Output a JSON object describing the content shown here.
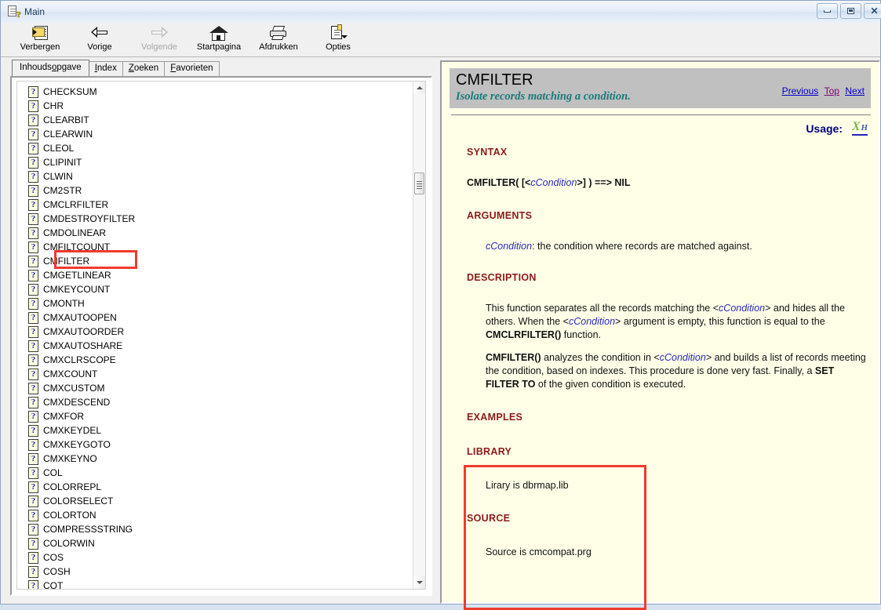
{
  "window": {
    "title": "Main",
    "icon": "help-document-icon",
    "buttons": {
      "minimize": "minimize",
      "restore": "restore",
      "close": "close"
    }
  },
  "toolbar": {
    "items": [
      {
        "label": "Verbergen",
        "icon": "hide-panel-icon",
        "enabled": true
      },
      {
        "label": "Vorige",
        "icon": "back-arrow-icon",
        "enabled": true
      },
      {
        "label": "Volgende",
        "icon": "forward-arrow-icon",
        "enabled": false
      },
      {
        "label": "Startpagina",
        "icon": "home-icon",
        "enabled": true
      },
      {
        "label": "Afdrukken",
        "icon": "printer-icon",
        "enabled": true
      },
      {
        "label": "Opties",
        "icon": "options-icon",
        "enabled": true
      }
    ]
  },
  "nav": {
    "tabs": [
      {
        "label": "Inhoudsopgave",
        "accesskey": "o",
        "active": true
      },
      {
        "label": "Index",
        "accesskey": "I",
        "active": false
      },
      {
        "label": "Zoeken",
        "accesskey": "Z",
        "active": false
      },
      {
        "label": "Favorieten",
        "accesskey": "F",
        "active": false
      }
    ],
    "tree_items": [
      "CHECKSUM",
      "CHR",
      "CLEARBIT",
      "CLEARWIN",
      "CLEOL",
      "CLIPINIT",
      "CLWIN",
      "CM2STR",
      "CMCLRFILTER",
      "CMDESTROYFILTER",
      "CMDOLINEAR",
      "CMFILTCOUNT",
      "CMFILTER",
      "CMGETLINEAR",
      "CMKEYCOUNT",
      "CMONTH",
      "CMXAUTOOPEN",
      "CMXAUTOORDER",
      "CMXAUTOSHARE",
      "CMXCLRSCOPE",
      "CMXCOUNT",
      "CMXCUSTOM",
      "CMXDESCEND",
      "CMXFOR",
      "CMXKEYDEL",
      "CMXKEYGOTO",
      "CMXKEYNO",
      "COL",
      "COLORREPL",
      "COLORSELECT",
      "COLORTON",
      "COMPRESSSTRING",
      "COLORWIN",
      "COS",
      "COSH",
      "COT"
    ],
    "highlighted_item": "CMFILTER",
    "scrollbar": {
      "up": "scroll-up",
      "down": "scroll-down"
    }
  },
  "document": {
    "title": "CMFILTER",
    "subtitle": "Isolate records matching a condition.",
    "nav_links": [
      {
        "label": "Previous",
        "state": "link"
      },
      {
        "label": "Top",
        "state": "visited"
      },
      {
        "label": "Next",
        "state": "link"
      }
    ],
    "usage_label": "Usage:",
    "usage_icon": "xharbour-logo-icon",
    "sections": {
      "syntax_head": "SYNTAX",
      "syntax_prefix": "CMFILTER( [<",
      "syntax_var": "cCondition",
      "syntax_suffix": ">] ) ==> ",
      "syntax_return": "NIL",
      "arguments_head": "ARGUMENTS",
      "arguments_var": "cCondition",
      "arguments_text": ": the condition where records are matched against.",
      "description_head": "DESCRIPTION",
      "desc_p1_a": "This function separates all the records matching the <",
      "desc_p1_var": "cCondition",
      "desc_p1_b": "> and hides all the others. When the <",
      "desc_p1_var2": "cCondition",
      "desc_p1_c": "> argument is empty, this function is equal to the ",
      "desc_p1_bold": "CMCLRFILTER()",
      "desc_p1_d": " function.",
      "desc_p2_bold": "CMFILTER()",
      "desc_p2_a": " analyzes the condition in <",
      "desc_p2_var": "cCondition",
      "desc_p2_b": "> and builds a list of records meeting the condition, based on indexes. This procedure is done very fast. Finally, a ",
      "desc_p2_bold2": "SET FILTER TO",
      "desc_p2_c": " of the given condition is executed.",
      "examples_head": "EXAMPLES",
      "library_head": "LIBRARY",
      "library_text": "Lirary is dbrmap.lib",
      "source_head": "SOURCE",
      "source_text": "Source is cmcompat.prg"
    }
  },
  "annotations": [
    {
      "name": "tree-cmfilter-highlight",
      "color": "#ef3b2d"
    },
    {
      "name": "library-source-highlight",
      "color": "#ef3b2d"
    }
  ],
  "colors": {
    "header_band": "#c0c0c0",
    "page_background": "#ffffe8",
    "section_heading": "#8b1a1a",
    "variable": "#2a2ab4",
    "subtitle": "#1a7a7a",
    "annotation": "#ef3b2d",
    "link": "#0000c8",
    "visited_link": "#800080"
  }
}
